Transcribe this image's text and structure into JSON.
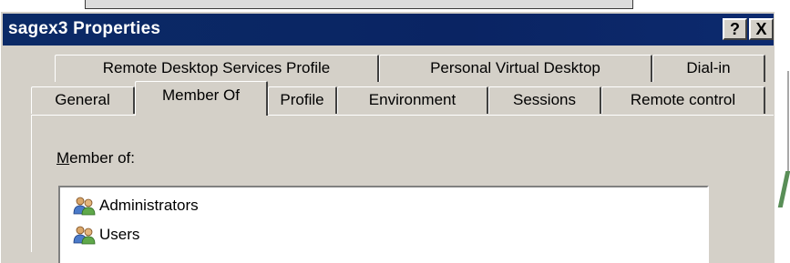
{
  "window": {
    "title": "sagex3 Properties",
    "help_label": "?",
    "close_label": "X"
  },
  "tabs": {
    "row1": [
      "Remote Desktop Services Profile",
      "Personal Virtual Desktop",
      "Dial-in"
    ],
    "row2": [
      "General",
      "Member Of",
      "Profile",
      "Environment",
      "Sessions",
      "Remote control"
    ],
    "selected": "Member Of"
  },
  "member_of": {
    "label_accesskey": "M",
    "label_rest": "ember of:",
    "items": [
      "Administrators",
      "Users"
    ],
    "item_icon": "user-group-icon"
  }
}
